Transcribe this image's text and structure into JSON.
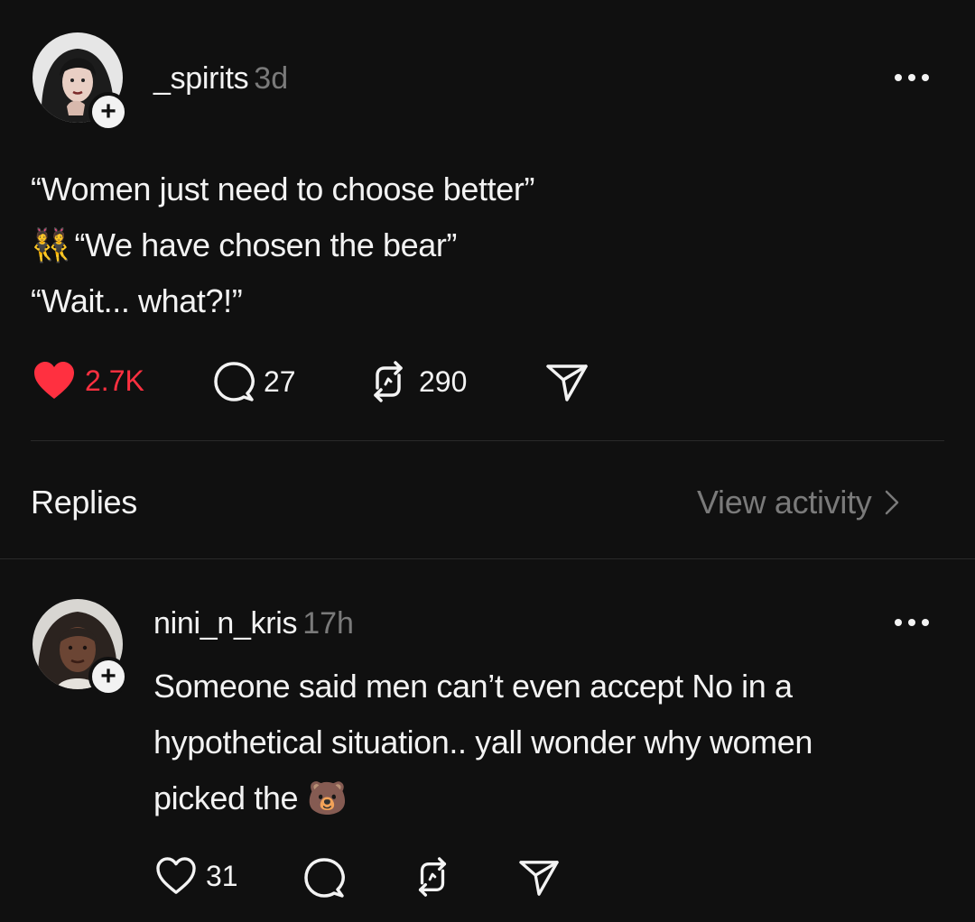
{
  "post": {
    "username": "_spirits",
    "time": "3d",
    "lines": [
      "“Women just need to choose better”",
      "“We have chosen the bear”",
      "“Wait... what?!”"
    ],
    "line2_emoji": "👯",
    "likes": "2.7K",
    "comments": "27",
    "reposts": "290",
    "liked_color": "#ff3040"
  },
  "section": {
    "replies_label": "Replies",
    "view_activity_label": "View activity"
  },
  "reply": {
    "username": "nini_n_kris",
    "time": "17h",
    "lines": [
      "Someone said men can’t even accept No in a",
      "hypothetical situation.. yall wonder why women",
      "picked the"
    ],
    "emoji": "🐻",
    "likes": "31"
  },
  "icons": {
    "follow": "plus-icon",
    "more": "more-icon",
    "like": "heart-icon",
    "comment": "comment-icon",
    "repost": "repost-icon",
    "share": "send-icon",
    "chevron": "chevron-right-icon"
  }
}
